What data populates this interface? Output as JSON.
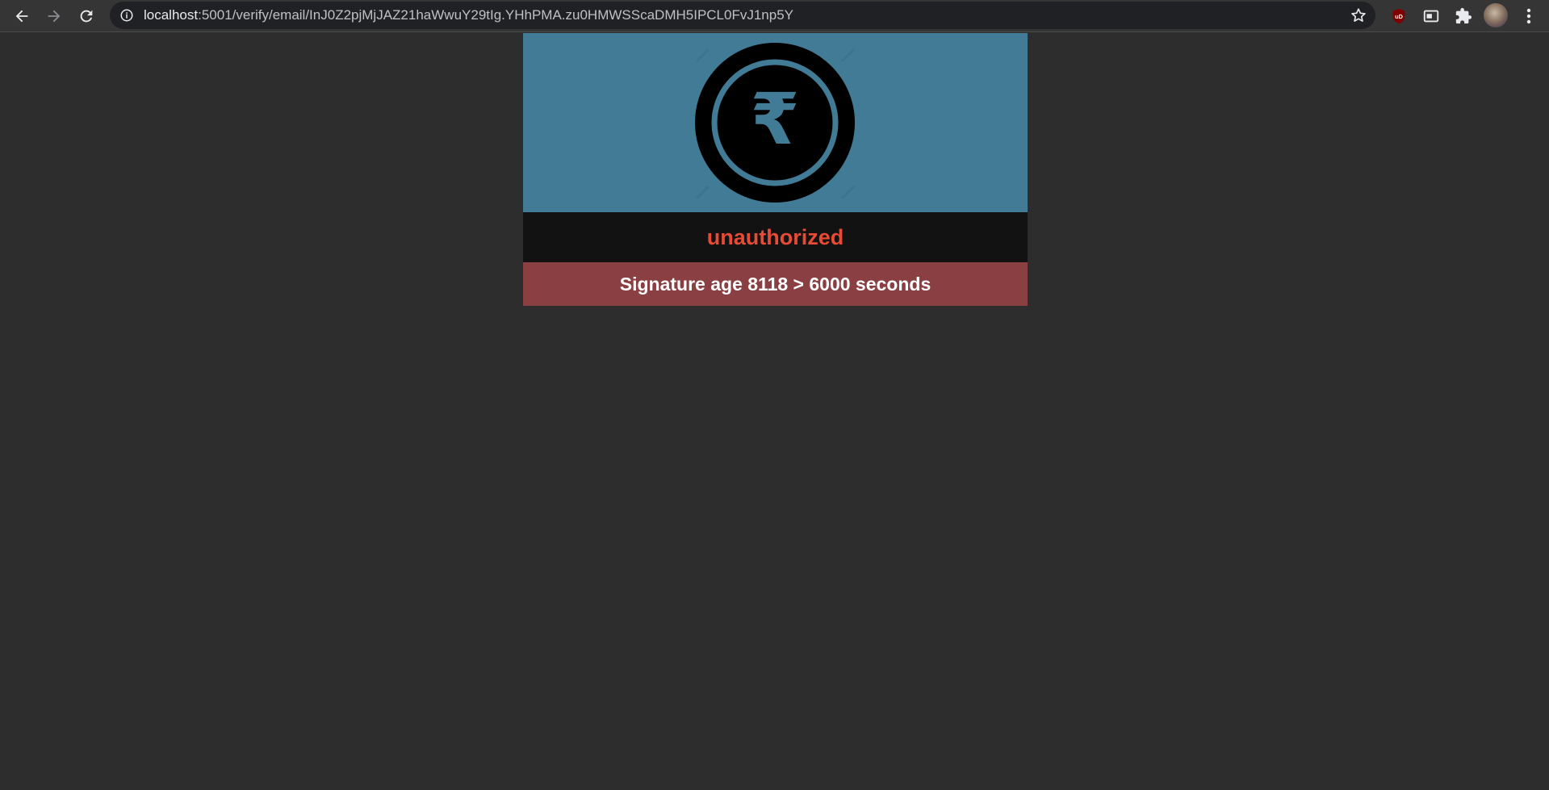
{
  "browser": {
    "url_host": "localhost",
    "url_path": ":5001/verify/email/InJ0Z2pjMjJAZ21haWwuY29tIg.YHhPMA.zu0HMWSScaDMH5IPCL0FvJ1np5Y",
    "icons": [
      "back-arrow-icon",
      "forward-arrow-icon",
      "reload-icon",
      "site-info-icon",
      "bookmark-star-icon",
      "ublock-origin-icon",
      "media-panel-icon",
      "extensions-puzzle-icon",
      "profile-avatar",
      "kebab-menu-icon"
    ],
    "ublock_badge": "uD"
  },
  "page": {
    "logo_symbol": "₹",
    "status": "unauthorized",
    "message": "Signature age 8118 > 6000 seconds"
  },
  "colors": {
    "page_background": "#2d2d2d",
    "hero_background": "#417b96",
    "status_bar": "#121212",
    "status_text": "#e84b35",
    "message_bar": "#8a3f42",
    "message_text": "#ffffff"
  }
}
